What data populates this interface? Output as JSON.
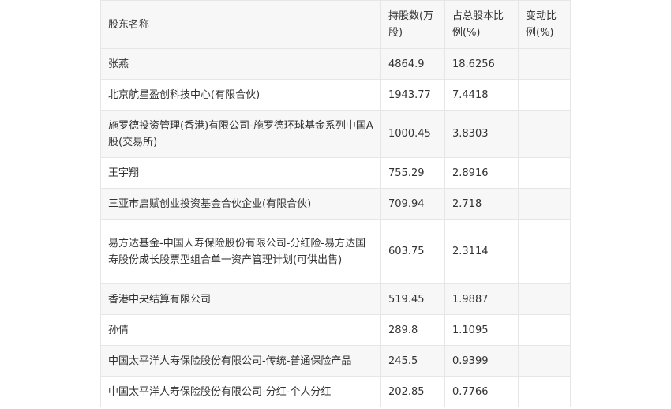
{
  "table": {
    "headers": [
      "股东名称",
      "持股数(万股)",
      "占总股本比例(%)",
      "变动比例(%)"
    ],
    "rows": [
      {
        "name": "张燕",
        "shares": "4864.9",
        "ratio": "18.6256",
        "change": ""
      },
      {
        "name": "北京航星盈创科技中心(有限合伙)",
        "shares": "1943.77",
        "ratio": "7.4418",
        "change": ""
      },
      {
        "name": "施罗德投资管理(香港)有限公司-施罗德环球基金系列中国A股(交易所)",
        "shares": "1000.45",
        "ratio": "3.8303",
        "change": ""
      },
      {
        "name": "王宇翔",
        "shares": "755.29",
        "ratio": "2.8916",
        "change": ""
      },
      {
        "name": "三亚市启赋创业投资基金合伙企业(有限合伙)",
        "shares": "709.94",
        "ratio": "2.718",
        "change": ""
      },
      {
        "name": "易方达基金-中国人寿保险股份有限公司-分红险-易方达国寿股份成长股票型组合单一资产管理计划(可供出售)",
        "shares": "603.75",
        "ratio": "2.3114",
        "change": ""
      },
      {
        "name": "香港中央结算有限公司",
        "shares": "519.45",
        "ratio": "1.9887",
        "change": ""
      },
      {
        "name": "孙倩",
        "shares": "289.8",
        "ratio": "1.1095",
        "change": ""
      },
      {
        "name": "中国太平洋人寿保险股份有限公司-传统-普通保险产品",
        "shares": "245.5",
        "ratio": "0.9399",
        "change": ""
      },
      {
        "name": "中国太平洋人寿保险股份有限公司-分红-个人分红",
        "shares": "202.85",
        "ratio": "0.7766",
        "change": ""
      }
    ]
  }
}
